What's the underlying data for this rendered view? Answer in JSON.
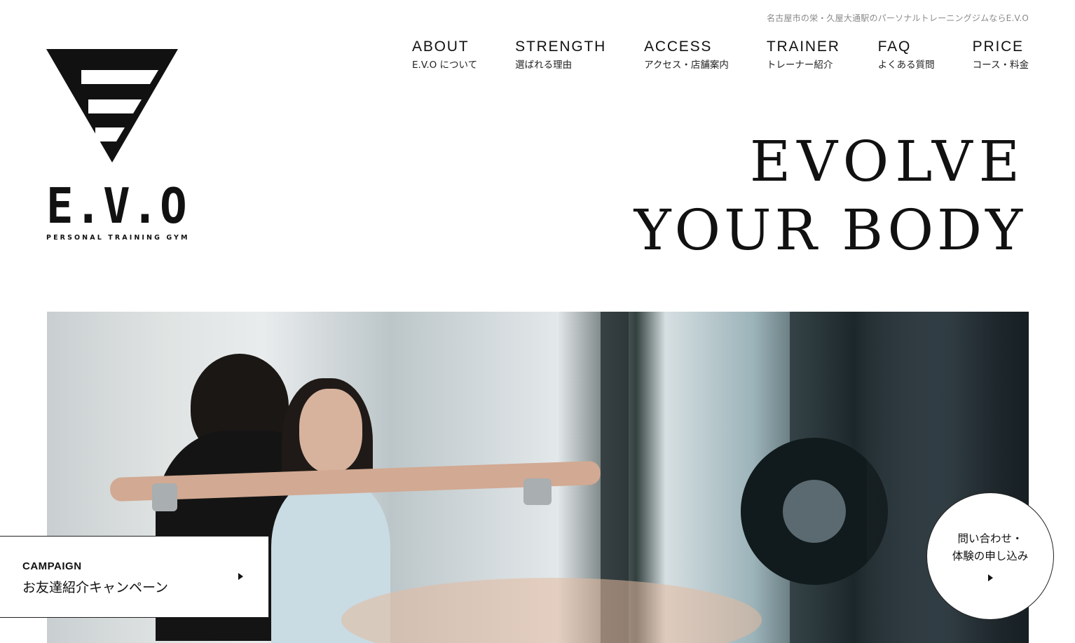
{
  "header": {
    "tagline": "名古屋市の栄・久屋大通駅のパーソナルトレーニングジムならE.V.O"
  },
  "logo": {
    "wordmark": "E.V.O",
    "subtitle": "PERSONAL TRAINING GYM"
  },
  "nav": {
    "items": [
      {
        "en": "ABOUT",
        "ja": "E.V.O について"
      },
      {
        "en": "STRENGTH",
        "ja": "選ばれる理由"
      },
      {
        "en": "ACCESS",
        "ja": "アクセス・店舗案内"
      },
      {
        "en": "TRAINER",
        "ja": "トレーナー紹介"
      },
      {
        "en": "FAQ",
        "ja": "よくある質問"
      },
      {
        "en": "PRICE",
        "ja": "コース・料金"
      }
    ]
  },
  "hero": {
    "line1": "EVOLVE",
    "line2": "YOUR BODY"
  },
  "campaign": {
    "label": "CAMPAIGN",
    "title": "お友達紹介キャンペーン"
  },
  "contact": {
    "line1": "問い合わせ・",
    "line2": "体験の申し込み"
  }
}
